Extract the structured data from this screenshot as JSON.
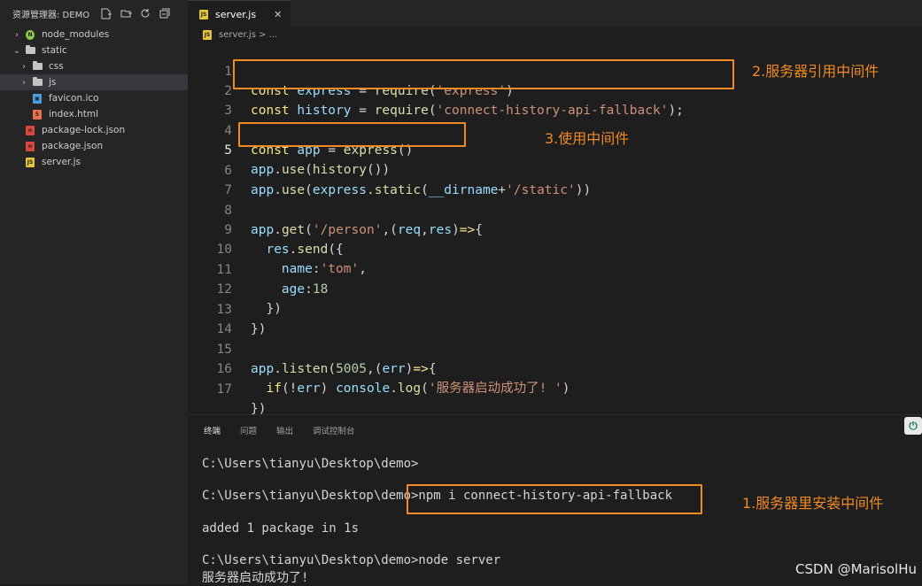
{
  "sidebar": {
    "title": "资源管理器: DEMO",
    "items": [
      {
        "label": "node_modules"
      },
      {
        "label": "static"
      },
      {
        "label": "css"
      },
      {
        "label": "js"
      },
      {
        "label": "favicon.ico"
      },
      {
        "label": "index.html"
      },
      {
        "label": "package-lock.json"
      },
      {
        "label": "package.json"
      },
      {
        "label": "server.js"
      }
    ]
  },
  "editor": {
    "tab_label": "server.js",
    "breadcrumb": "server.js > ...",
    "line_numbers": [
      "1",
      "2",
      "3",
      "4",
      "5",
      "6",
      "7",
      "8",
      "9",
      "10",
      "11",
      "12",
      "13",
      "14",
      "15",
      "16",
      "17"
    ]
  },
  "annotations": {
    "a2": "2.服务器引用中间件",
    "a3": "3.使用中间件",
    "a1": "1.服务器里安装中间件"
  },
  "panel": {
    "tabs": [
      "终端",
      "问题",
      "输出",
      "调试控制台"
    ],
    "lines": [
      "C:\\Users\\tianyu\\Desktop\\demo>",
      "C:\\Users\\tianyu\\Desktop\\demo>npm i connect-history-api-fallback",
      "added 1 package in 1s",
      "C:\\Users\\tianyu\\Desktop\\demo>node server",
      "服务器启动成功了!"
    ]
  },
  "watermark": "CSDN @MarisolHu",
  "colors": {
    "accent": "#f08a24",
    "keyword": "#f5e58a",
    "identifier": "#9cdcfe",
    "string": "#ce9178"
  }
}
